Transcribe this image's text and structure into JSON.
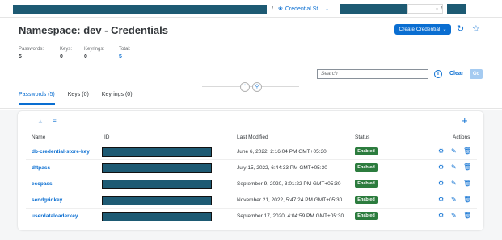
{
  "shellbar": {
    "breadcrumb_separator_1": "/",
    "breadcrumb_item": "Credential St...",
    "breadcrumb_separator_2": "/",
    "chevron_glyph": "⌄",
    "breadcrumb_icon": "paw-icon"
  },
  "header": {
    "title": "Namespace: dev - Credentials",
    "create_button": "Create Credential",
    "refresh_icon": "↻",
    "favorite_icon": "☆",
    "kpis": [
      {
        "label": "Passwords:",
        "value": "5"
      },
      {
        "label": "Keys:",
        "value": "0"
      },
      {
        "label": "Keyrings:",
        "value": "0"
      },
      {
        "label": "Total:",
        "value": "5"
      }
    ],
    "search_placeholder": "Search",
    "info_glyph": "i",
    "clear_label": "Clear",
    "go_label": "Go",
    "collapse_glyph": "⌃",
    "pin_glyph": "⚲"
  },
  "tabs": [
    {
      "label": "Passwords (5)",
      "active": true
    },
    {
      "label": "Keys (0)",
      "active": false
    },
    {
      "label": "Keyrings (0)",
      "active": false
    }
  ],
  "table": {
    "sort_asc_glyph": "▲",
    "sort_desc_glyph": "≡",
    "add_glyph": "+",
    "columns": {
      "name": "Name",
      "id": "ID",
      "last_modified": "Last Modified",
      "status": "Status",
      "actions": "Actions"
    },
    "action_glyphs": {
      "settings": "⚙",
      "edit": "✎",
      "delete": "🗑"
    },
    "rows": [
      {
        "name": "db-credential-store-key",
        "last_modified": "June 6, 2022, 2:16:04 PM GMT+05:30",
        "status": "Enabled"
      },
      {
        "name": "dftpass",
        "last_modified": "July 15, 2022, 6:44:33 PM GMT+05:30",
        "status": "Enabled"
      },
      {
        "name": "eccpass",
        "last_modified": "September 9, 2020, 3:01:22 PM GMT+05:30",
        "status": "Enabled"
      },
      {
        "name": "sendgridkey",
        "last_modified": "November 21, 2022, 5:47:24 PM GMT+05:30",
        "status": "Enabled"
      },
      {
        "name": "userdataloaderkey",
        "last_modified": "September 17, 2020, 4:04:59 PM GMT+05:30",
        "status": "Enabled"
      }
    ]
  },
  "colors": {
    "accent": "#0a6ed1",
    "status_enabled": "#2c7c3e",
    "redaction": "#1d5a73"
  }
}
